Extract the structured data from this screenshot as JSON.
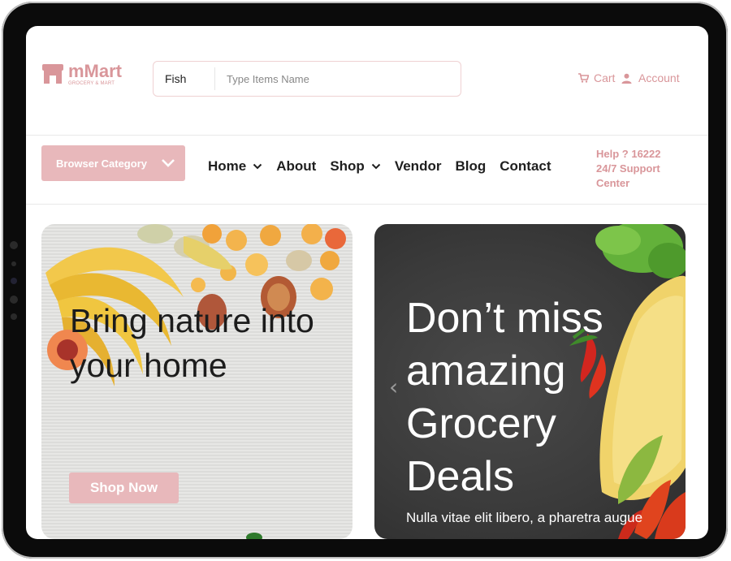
{
  "brand": {
    "name": "mMart",
    "tagline": "GROCERY & MART",
    "color": "#d9969a"
  },
  "search": {
    "category": "Fish",
    "placeholder": "Type Items Name"
  },
  "header_links": {
    "cart": "Cart",
    "account": "Account"
  },
  "browse": {
    "label": "Browser Category"
  },
  "nav": {
    "items": [
      {
        "label": "Home",
        "has_dropdown": true
      },
      {
        "label": "About",
        "has_dropdown": false
      },
      {
        "label": "Shop",
        "has_dropdown": true
      },
      {
        "label": "Vendor",
        "has_dropdown": false
      },
      {
        "label": "Blog",
        "has_dropdown": false
      },
      {
        "label": "Contact",
        "has_dropdown": false
      }
    ]
  },
  "help": {
    "line1": "Help ? 16222",
    "line2": "24/7 Support",
    "line3": "Center"
  },
  "banners": {
    "left": {
      "title": "Bring nature into your home",
      "button": "Shop Now"
    },
    "right": {
      "title": "Don’t miss amazing Grocery Deals",
      "subtitle": "Nulla vitae elit libero, a pharetra augue"
    }
  },
  "colors": {
    "accent": "#e8b8bb",
    "accent_text": "#d9969a",
    "dark_banner": "#3a3a3a"
  },
  "icons": [
    "store-logo-icon",
    "cart-icon",
    "account-icon",
    "chevron-down-icon",
    "prev-arrow-icon"
  ]
}
